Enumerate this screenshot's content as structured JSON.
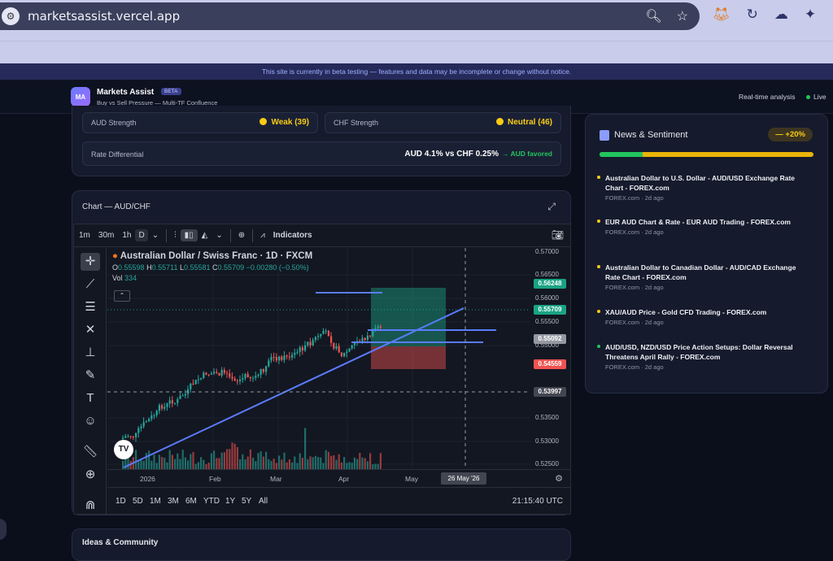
{
  "browser": {
    "url": "marketsassist.vercel.app",
    "icons": [
      "search-icon",
      "star-icon",
      "metamask-icon",
      "history-icon",
      "ghost-icon",
      "extensions-icon"
    ]
  },
  "banner": {
    "text": "This site is currently in beta testing — features and data may be incomplete or change without notice."
  },
  "header": {
    "logo_text": "MA",
    "title": "Markets Assist",
    "badge": "BETA",
    "subtitle": "Buy vs Sell Pressure — Multi-TF Confluence",
    "realtime": "Real-time analysis",
    "live": "Live"
  },
  "strength": {
    "aud_label": "AUD Strength",
    "aud_value": "Weak (39)",
    "chf_label": "CHF Strength",
    "chf_value": "Neutral (46)",
    "rate_label": "Rate Differential",
    "rate_value": "AUD 4.1% vs CHF 0.25%",
    "rate_favored": "→ AUD favored"
  },
  "chart_card": {
    "title": "Chart — AUD/CHF",
    "toolbar": {
      "intervals": [
        "1m",
        "30m",
        "1h",
        "D"
      ],
      "indicators": "Indicators"
    },
    "legend": {
      "symbol": "Australian Dollar / Swiss Franc · 1D · FXCM",
      "o_label": "O",
      "o": "0.55598",
      "h_label": "H",
      "h": "0.55711",
      "l_label": "L",
      "l": "0.55581",
      "c_label": "C",
      "c": "0.55709",
      "change": "−0.00280 (−0.50%)",
      "vol_label": "Vol",
      "vol": "334"
    },
    "price_axis": [
      "0.57000",
      "0.56500",
      "0.56000",
      "0.55500",
      "0.55000",
      "0.53500",
      "0.53000",
      "0.52500"
    ],
    "price_tags": [
      {
        "value": "0.56248",
        "color": "#1aa384"
      },
      {
        "value": "0.55709",
        "color": "#1aa384"
      },
      {
        "value": "0.55092",
        "color": "#9598a1"
      },
      {
        "value": "0.54559",
        "color": "#ef5350"
      },
      {
        "value": "0.53997",
        "color": "#434651"
      }
    ],
    "time_axis": [
      "2026",
      "Feb",
      "Mar",
      "Apr",
      "May"
    ],
    "time_hover": "26 May '26",
    "ranges": [
      "1D",
      "5D",
      "1M",
      "3M",
      "6M",
      "YTD",
      "1Y",
      "5Y",
      "All"
    ],
    "clock": "21:15:40 UTC"
  },
  "news": {
    "title": "News & Sentiment",
    "badge": "— +20%",
    "sentiment_bullish": 0.2,
    "items": [
      {
        "headline": "Australian Dollar to U.S. Dollar - AUD/USD Exchange Rate Chart - FOREX.com",
        "meta": "FOREX.com · 2d ago",
        "dot": "#facc15"
      },
      {
        "headline": "EUR AUD Chart & Rate - EUR AUD Trading - FOREX.com",
        "meta": "FOREX.com · 2d ago",
        "dot": "#facc15"
      },
      {
        "headline": "Australian Dollar to Canadian Dollar - AUD/CAD Exchange Rate Chart - FOREX.com",
        "meta": "FOREX.com · 2d ago",
        "dot": "#facc15"
      },
      {
        "headline": "XAU/AUD Price - Gold CFD Trading - FOREX.com",
        "meta": "FOREX.com · 2d ago",
        "dot": "#facc15"
      },
      {
        "headline": "AUD/USD, NZD/USD Price Action Setups: Dollar Reversal Threatens April Rally - FOREX.com",
        "meta": "FOREX.com · 2d ago",
        "dot": "#22c55e"
      }
    ]
  },
  "ideas": {
    "title": "Ideas & Community"
  }
}
